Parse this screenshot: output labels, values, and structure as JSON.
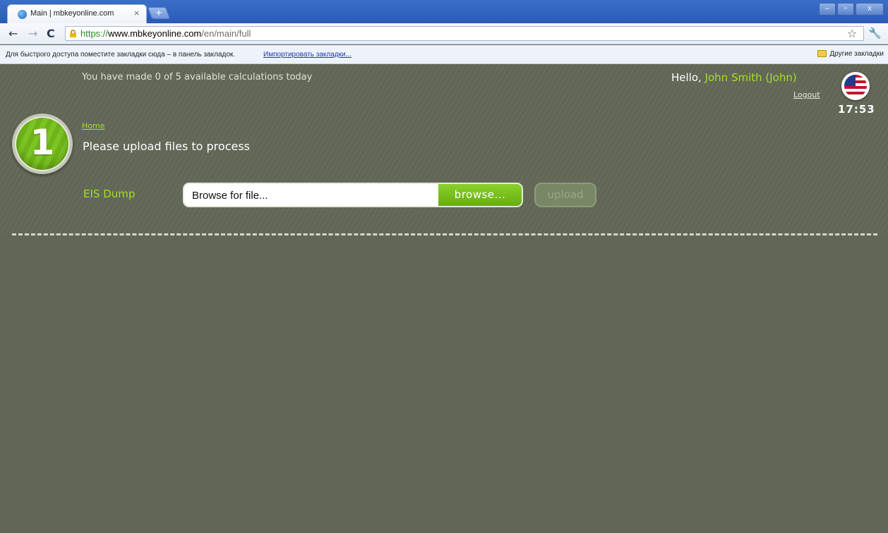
{
  "browser": {
    "tab_title": "Main | mbkeyonline.com",
    "tab_close": "×",
    "new_tab": "+",
    "win_min": "–",
    "win_max": "▫",
    "win_close": "x",
    "url_scheme": "https://",
    "url_host": "www.mbkeyonline.com",
    "url_path": "/en/main/full",
    "bookmarks_hint": "Для быстрого доступа поместите закладки сюда – в панель закладок.",
    "bookmarks_import": "Импортировать закладки...",
    "bookmarks_other": "Другие закладки"
  },
  "header": {
    "calculations_text": "You have made 0 of 5 available calculations today",
    "greeting": "Hello, ",
    "user_name": "John Smith (John)",
    "logout": "Logout",
    "time": "17:53"
  },
  "step": {
    "number": "1",
    "breadcrumb_home": "Home",
    "title": "Please upload files to process"
  },
  "upload_form": {
    "label": "EIS Dump",
    "file_placeholder": "Browse for file...",
    "browse_label": "browse...",
    "upload_label": "upload"
  },
  "colors": {
    "background": "#616656",
    "accent_green": "#a6e01f",
    "browse_green": "#78bf1c"
  }
}
